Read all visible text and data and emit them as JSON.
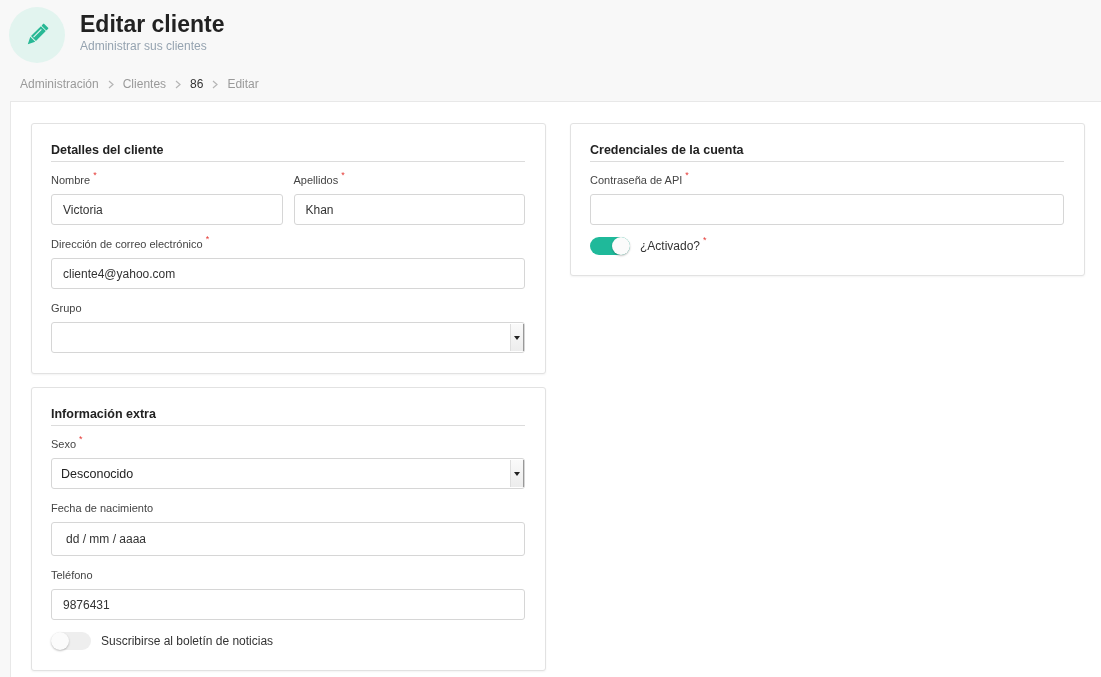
{
  "header": {
    "title": "Editar cliente",
    "subtitle": "Administrar sus clientes"
  },
  "breadcrumb": [
    {
      "label": "Administración",
      "emphasized": false
    },
    {
      "label": "Clientes",
      "emphasized": false
    },
    {
      "label": "86",
      "emphasized": true
    },
    {
      "label": "Editar",
      "emphasized": false
    }
  ],
  "columns": [
    {
      "cards": [
        {
          "title": "Detalles del cliente",
          "rows": [
            {
              "fields": [
                {
                  "kind": "text",
                  "label": "Nombre",
                  "required_mark": "*",
                  "value": "Victoria"
                },
                {
                  "kind": "text",
                  "label": "Apellidos",
                  "required_mark": "*",
                  "value": "Khan"
                }
              ]
            },
            {
              "fields": [
                {
                  "kind": "text",
                  "label": "Dirección de correo electrónico",
                  "required_mark": "*",
                  "value": "cliente4@yahoo.com"
                }
              ]
            },
            {
              "fields": [
                {
                  "kind": "select",
                  "label": "Grupo"
                }
              ]
            }
          ]
        },
        {
          "title": "Información extra",
          "rows": [
            {
              "fields": [
                {
                  "kind": "select",
                  "label": "Sexo",
                  "required_mark": "*",
                  "value": "Desconocido"
                }
              ]
            },
            {
              "fields": [
                {
                  "kind": "date",
                  "label": "Fecha de nacimiento",
                  "placeholder": "dd / mm / aaaa"
                }
              ]
            },
            {
              "fields": [
                {
                  "kind": "text",
                  "label": "Teléfono",
                  "value": "9876431"
                }
              ]
            },
            {
              "fields": [
                {
                  "kind": "toggle",
                  "label": "Suscribirse al boletín de noticias",
                  "on": false
                }
              ]
            }
          ]
        }
      ]
    },
    {
      "cards": [
        {
          "title": "Credenciales de la cuenta",
          "rows": [
            {
              "fields": [
                {
                  "kind": "password",
                  "label": "Contraseña de API",
                  "required_mark": "*"
                }
              ]
            },
            {
              "fields": [
                {
                  "kind": "toggle",
                  "label": "¿Activado?",
                  "required_mark": "*",
                  "on": true
                }
              ]
            }
          ]
        }
      ]
    }
  ]
}
